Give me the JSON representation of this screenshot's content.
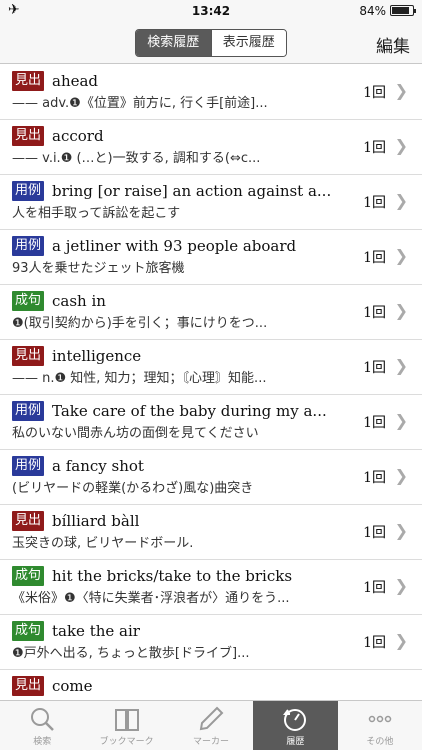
{
  "status": {
    "time": "13:42",
    "battery_text": "84%",
    "battery_level": 0.84
  },
  "nav": {
    "segments": [
      {
        "label": "検索履歴",
        "active": true
      },
      {
        "label": "表示履歴",
        "active": false
      }
    ],
    "edit_label": "編集"
  },
  "history": [
    {
      "type": "見出",
      "term": "ahead",
      "definition": "—— adv.❶《位置》前方に, 行く手[前途]...",
      "count": "1回"
    },
    {
      "type": "見出",
      "term": "accord",
      "definition": "—— v.i.❶ (…と)一致する, 調和する(⇔c...",
      "count": "1回"
    },
    {
      "type": "用例",
      "term": "bring [or raise] an action against a...",
      "definition": "人を相手取って訴訟を起こす",
      "count": "1回"
    },
    {
      "type": "用例",
      "term": "a jetliner with 93 people aboard",
      "definition": "93人を乗せたジェット旅客機",
      "count": "1回"
    },
    {
      "type": "成句",
      "term": "cash in",
      "definition": "❶(取引契約から)手を引く；事にけりをつ...",
      "count": "1回"
    },
    {
      "type": "見出",
      "term": "intelligence",
      "definition": "—— n.❶ 知性, 知力；理知；〘心理〙知能...",
      "count": "1回"
    },
    {
      "type": "用例",
      "term": "Take care of the baby during my a...",
      "definition": "私のいない間赤ん坊の面倒を見てください",
      "count": "1回"
    },
    {
      "type": "用例",
      "term": "a fancy shot",
      "definition": "(ビリヤードの軽業(かるわざ)風な)曲突き",
      "count": "1回"
    },
    {
      "type": "見出",
      "term": "bílliard bàll",
      "definition": "玉突きの球, ビリヤードボール.",
      "count": "1回"
    },
    {
      "type": "成句",
      "term": "hit the bricks/take to the bricks",
      "definition": "《米俗》❶〈特に失業者･浮浪者が〉通りをう...",
      "count": "1回"
    },
    {
      "type": "成句",
      "term": "take the air",
      "definition": "❶戸外へ出る, ちょっと散歩[ドライブ]...",
      "count": "1回"
    },
    {
      "type": "見出",
      "term": "come",
      "definition": "",
      "count": ""
    }
  ],
  "tabs": [
    {
      "label": "検索",
      "icon": "search-icon",
      "active": false
    },
    {
      "label": "ブックマーク",
      "icon": "book-icon",
      "active": false
    },
    {
      "label": "マーカー",
      "icon": "pen-icon",
      "active": false
    },
    {
      "label": "履歴",
      "icon": "history-icon",
      "active": true
    },
    {
      "label": "その他",
      "icon": "more-icon",
      "active": false
    }
  ],
  "colors": {
    "headword": "#8f1a1a",
    "example": "#2a3a9a",
    "phrase": "#2f8a2f",
    "active_tab": "#5a5a5a"
  }
}
